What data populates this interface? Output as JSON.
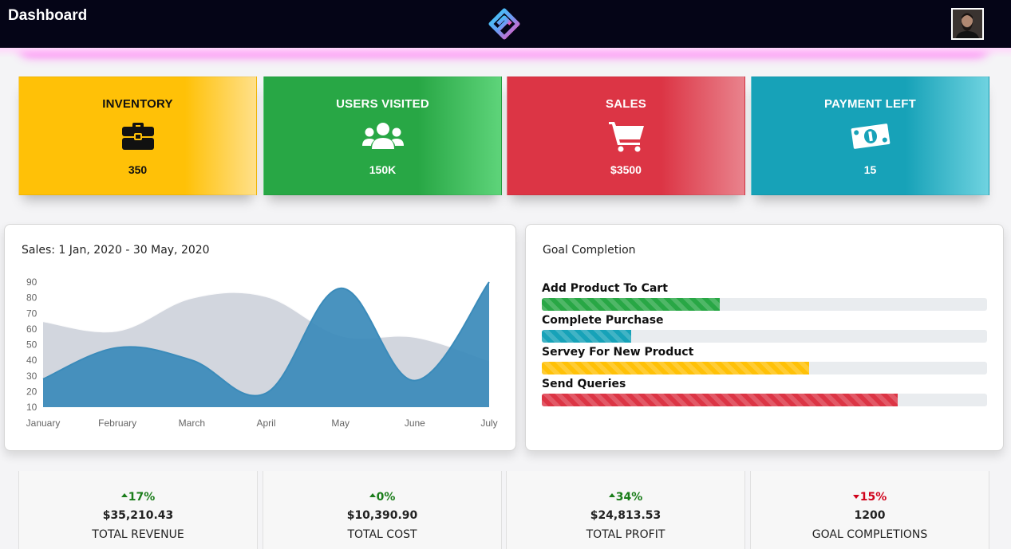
{
  "header": {
    "title": "Dashboard",
    "logo_icon": "brand-logo-icon",
    "avatar_icon": "user-avatar-icon"
  },
  "kpis": [
    {
      "title": "INVENTORY",
      "value": "350",
      "icon": "briefcase-icon",
      "color": "#ffc107"
    },
    {
      "title": "USERS VISITED",
      "value": "150K",
      "icon": "users-icon",
      "color": "#28a745"
    },
    {
      "title": "SALES",
      "value": "$3500",
      "icon": "cart-icon",
      "color": "#dc3545"
    },
    {
      "title": "PAYMENT LEFT",
      "value": "15",
      "icon": "money-bill-icon",
      "color": "#17a2b8"
    }
  ],
  "sales_panel": {
    "title": "Sales: 1 Jan, 2020 - 30 May, 2020"
  },
  "chart_data": {
    "type": "area",
    "categories": [
      "January",
      "February",
      "March",
      "April",
      "May",
      "June",
      "July"
    ],
    "series": [
      {
        "values": [
          65,
          59,
          80,
          81,
          56,
          55,
          40
        ],
        "color": "#d2d6de"
      },
      {
        "values": [
          28,
          48,
          40,
          19,
          86,
          27,
          90
        ],
        "color": "#3b8bba"
      }
    ],
    "yticks": [
      10,
      20,
      30,
      40,
      50,
      60,
      70,
      80,
      90
    ],
    "ylim": [
      10,
      90
    ],
    "grid": false,
    "legend": "none"
  },
  "goals_panel": {
    "title": "Goal Completion",
    "items": [
      {
        "label": "Add Product To Cart",
        "progress": 0.4,
        "color": "#28a745"
      },
      {
        "label": "Complete Purchase",
        "progress": 0.2,
        "color": "#17a2b8"
      },
      {
        "label": "Servey For New Product",
        "progress": 0.6,
        "color": "#ffc107"
      },
      {
        "label": "Send Queries",
        "progress": 0.8,
        "color": "#dc3545"
      }
    ]
  },
  "stats": [
    {
      "delta": "17%",
      "direction": "up",
      "amount": "$35,210.43",
      "label": "TOTAL REVENUE"
    },
    {
      "delta": "0%",
      "direction": "up",
      "amount": "$10,390.90",
      "label": "TOTAL COST"
    },
    {
      "delta": "34%",
      "direction": "up",
      "amount": "$24,813.53",
      "label": "TOTAL PROFIT"
    },
    {
      "delta": "15%",
      "direction": "down",
      "amount": "1200",
      "label": "GOAL COMPLETIONS"
    }
  ]
}
